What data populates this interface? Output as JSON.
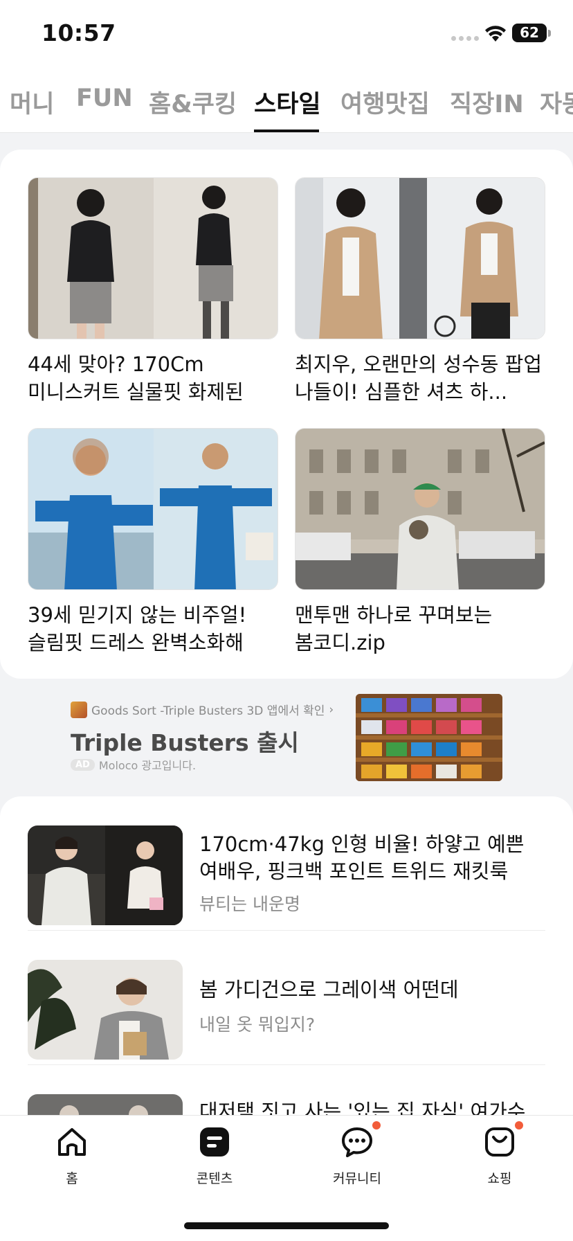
{
  "status_bar": {
    "time": "10:57",
    "battery": "62"
  },
  "tabs": [
    {
      "label": "머니"
    },
    {
      "label": "FUN"
    },
    {
      "label": "홈&쿠킹"
    },
    {
      "label": "스타일"
    },
    {
      "label": "여행맛집"
    },
    {
      "label": "직장IN"
    },
    {
      "label": "자동차"
    }
  ],
  "grid": [
    {
      "title": "44세 맞아? 170Cm 미니스커트 실물핏 화제된 여배우..."
    },
    {
      "title": "최지우, 오랜만의 성수동 팝업 나들이! 심플한 셔츠 하..."
    },
    {
      "title": "39세 믿기지 않는 비주얼!슬림핏 드레스 완벽소화해 놀..."
    },
    {
      "title": "맨투맨 하나로 꾸며보는 봄코디.zip"
    }
  ],
  "ad": {
    "source": "Goods Sort -Triple Busters 3D 앱에서 확인",
    "source_arrow": "›",
    "title": "Triple Busters 출시",
    "badge": "AD",
    "advertiser": "Moloco 광고입니다."
  },
  "list": [
    {
      "title": "170cm·47kg 인형 비율! 하얗고 예쁜 여배우, 핑크백 포인트 트위드 재킷룩",
      "subtitle": "뷰티는 내운명"
    },
    {
      "title": "봄 가디건으로 그레이색 어떤데",
      "subtitle": "내일 옷 뭐입지?"
    },
    {
      "title": "대저택 짓고 사는 '있는 집 자식' 여가수",
      "subtitle": ""
    }
  ],
  "bottom_nav": [
    {
      "label": "홈",
      "icon": "home-icon",
      "badge": false
    },
    {
      "label": "콘텐츠",
      "icon": "contents-icon",
      "badge": false
    },
    {
      "label": "커뮤니티",
      "icon": "community-icon",
      "badge": true
    },
    {
      "label": "쇼핑",
      "icon": "shopping-icon",
      "badge": true
    }
  ],
  "colors": {
    "accent": "#111111",
    "inactive_tab": "#9a9a9a",
    "badge_dot": "#f25c3a"
  }
}
